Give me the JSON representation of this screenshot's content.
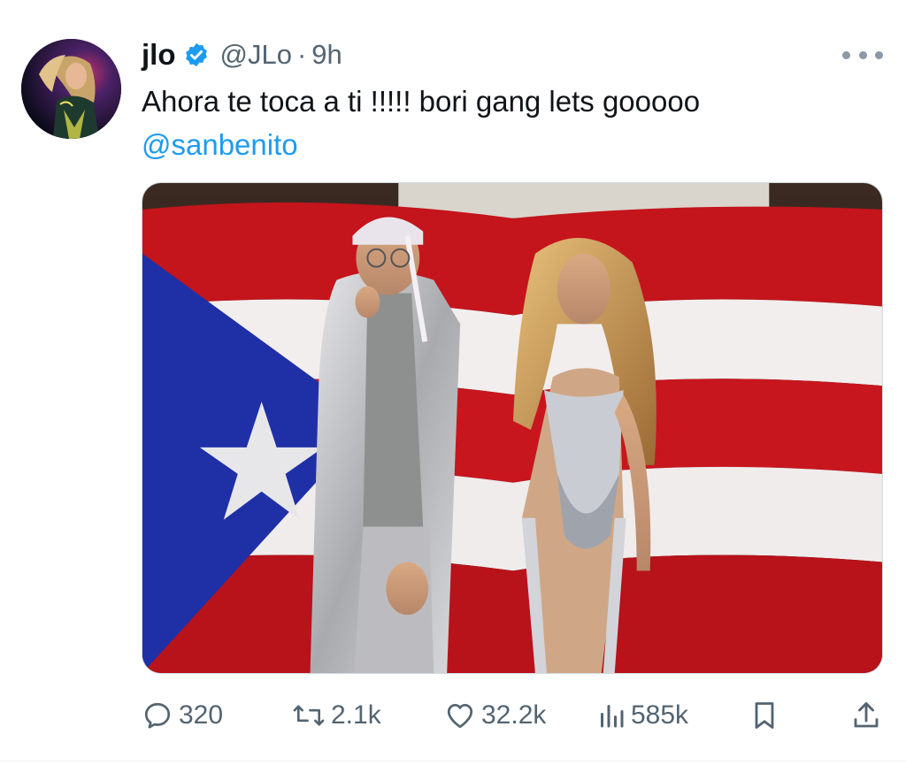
{
  "tweet": {
    "author": {
      "name": "jlo",
      "handle": "@JLo",
      "separator": "·",
      "time": "9h",
      "verified": true
    },
    "text": "Ahora te toca a ti !!!!! bori gang lets gooooo",
    "mention": "@sanbenito",
    "media": {
      "alt": "Photo"
    },
    "actions": {
      "replies": "320",
      "reposts": "2.1k",
      "likes": "32.2k",
      "views": "585k"
    },
    "icons": {
      "more": "more-icon",
      "verified": "verified-badge-icon",
      "reply": "reply-icon",
      "repost": "repost-icon",
      "like": "heart-icon",
      "views": "views-icon",
      "bookmark": "bookmark-icon",
      "share": "share-icon"
    },
    "colors": {
      "accent": "#1d9bf0",
      "secondary_text": "#536471",
      "primary_text": "#0f1419"
    }
  }
}
